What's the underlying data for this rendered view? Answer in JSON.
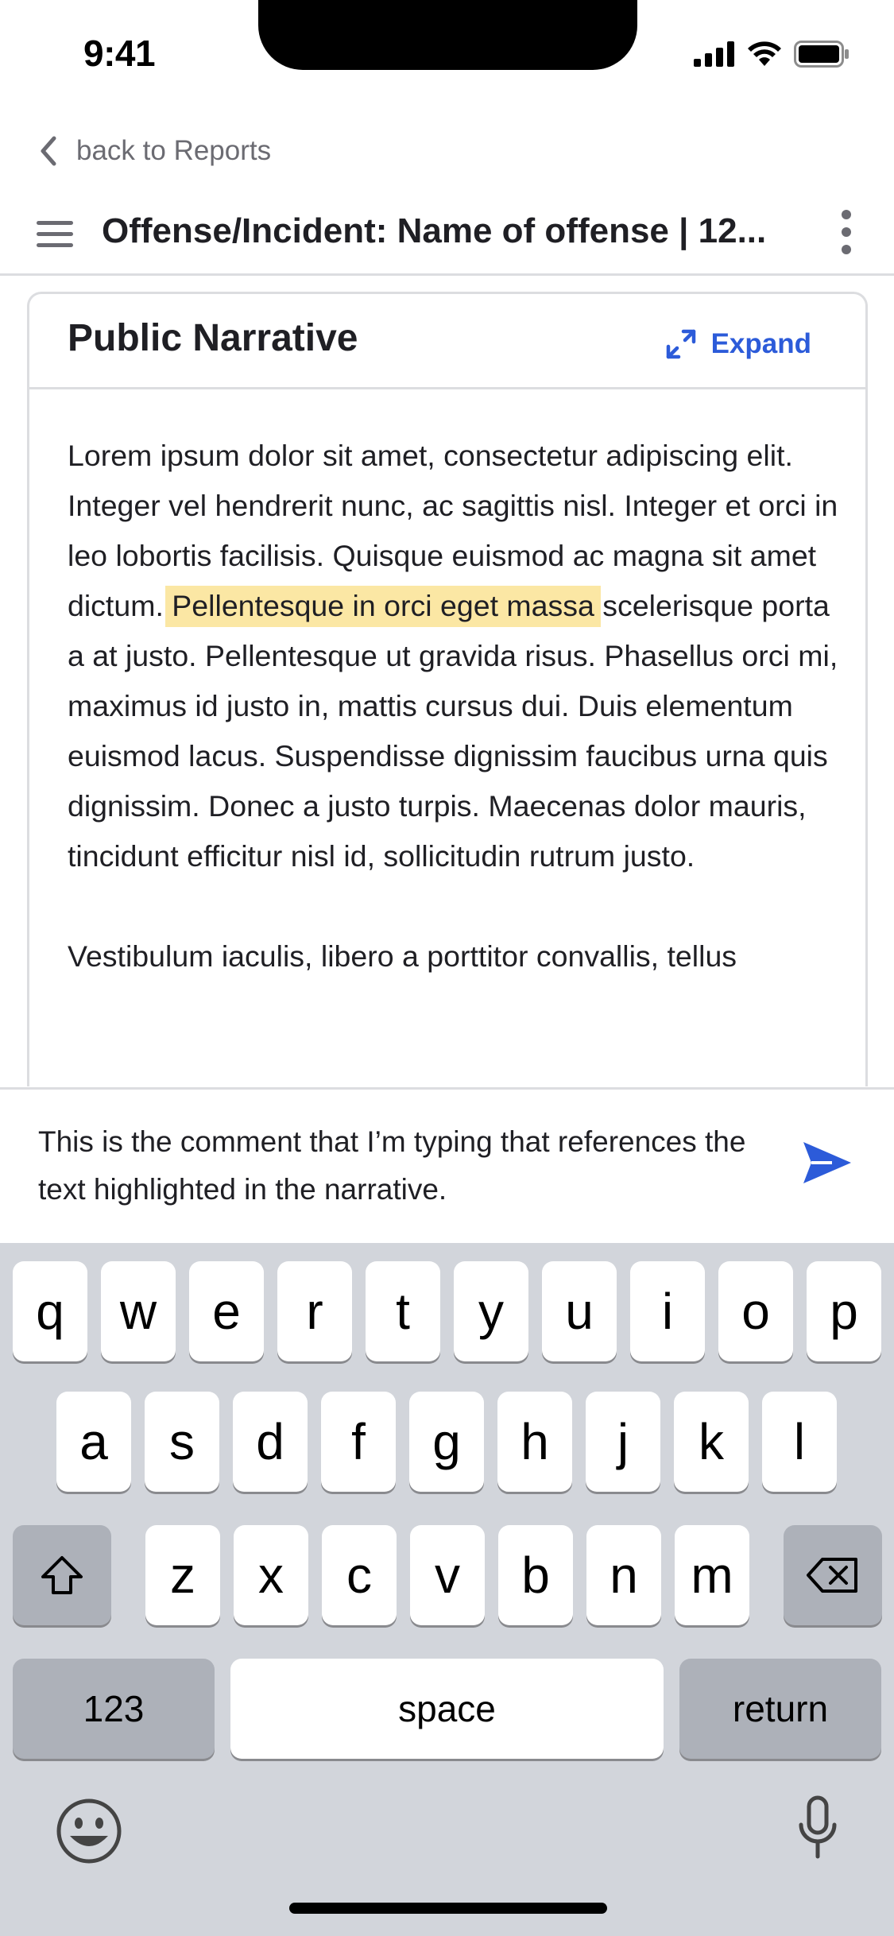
{
  "status_bar": {
    "time": "9:41"
  },
  "nav": {
    "back_label": "back to Reports",
    "title": "Offense/Incident: Name of offense | 12..."
  },
  "narrative": {
    "title": "Public Narrative",
    "expand_label": "Expand",
    "paragraph1_before": "Lorem ipsum dolor sit amet, consectetur adipiscing elit. Integer vel hendrerit nunc, ac sagittis nisl. Integer et orci in leo lobortis facilisis. Quisque euismod ac magna sit amet dictum.",
    "paragraph1_highlight": "Pellentesque in orci eget massa",
    "paragraph1_after": "scelerisque porta a at justo. Pellentesque ut gravida risus. Phasellus orci mi, maximus id justo in, mattis cursus dui. Duis elementum euismod lacus. Suspendisse dignissim faucibus urna quis dignissim. Donec a justo turpis. Maecenas dolor mauris, tincidunt efficitur nisl id, sollicitudin rutrum justo.",
    "paragraph2": "Vestibulum iaculis, libero a porttitor convallis, tellus"
  },
  "comment": {
    "value": "This is the comment that I’m typing that references the text highlighted in the narrative."
  },
  "keyboard": {
    "row1": [
      "q",
      "w",
      "e",
      "r",
      "t",
      "y",
      "u",
      "i",
      "o",
      "p"
    ],
    "row2": [
      "a",
      "s",
      "d",
      "f",
      "g",
      "h",
      "j",
      "k",
      "l"
    ],
    "row3": [
      "z",
      "x",
      "c",
      "v",
      "b",
      "n",
      "m"
    ],
    "numbers_label": "123",
    "space_label": "space",
    "return_label": "return"
  },
  "colors": {
    "accent": "#2c5bd9",
    "highlight": "#fbe7a4",
    "keyboard_bg": "#d2d5db"
  }
}
